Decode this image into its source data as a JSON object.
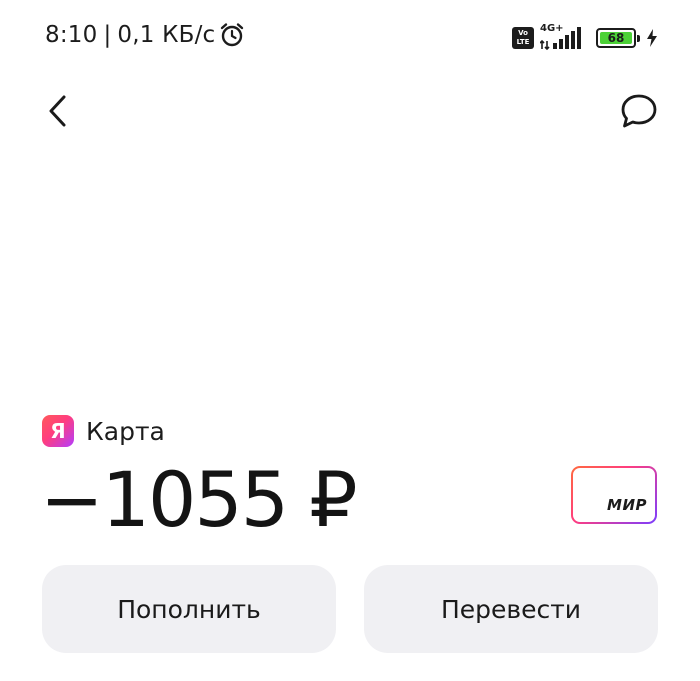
{
  "status_bar": {
    "time": "8:10",
    "separator": "|",
    "network_speed": "0,1 КБ/с",
    "volte_top": "Vo",
    "volte_bottom": "LTE",
    "network_type": "4G+",
    "battery_level": "68",
    "battery_color": "#4cd137",
    "icons": [
      "alarm-icon",
      "volte-icon",
      "signal-icon",
      "battery-icon",
      "charging-bolt-icon"
    ]
  },
  "header": {
    "back_icon": "chevron-left-icon",
    "chat_icon": "chat-bubble-icon"
  },
  "account": {
    "logo_letter": "Я",
    "name": "Карта",
    "balance": "−1055 ₽",
    "card_brand": "МИР"
  },
  "actions": {
    "top_up_label": "Пополнить",
    "transfer_label": "Перевести"
  },
  "colors": {
    "button_bg": "#f0f0f3",
    "logo_gradient_start": "#ff5a5a",
    "logo_gradient_end": "#b23dff"
  }
}
